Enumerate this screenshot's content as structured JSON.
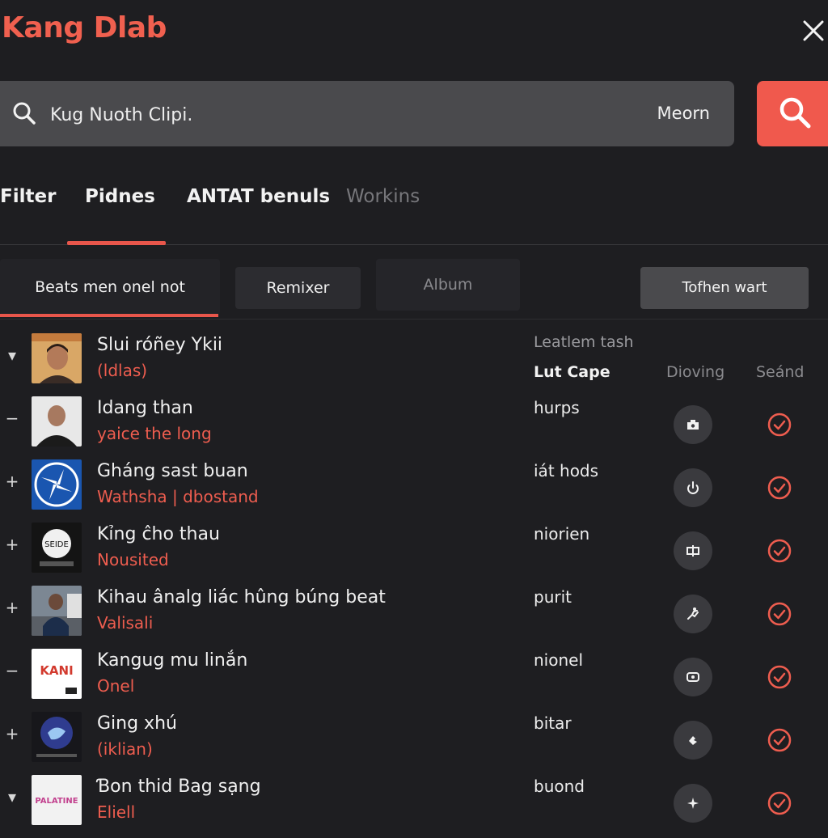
{
  "app": {
    "logo": "Kang Dlab"
  },
  "search": {
    "value": "Kug Nuoth Clipi.",
    "aux_label": "Meorn"
  },
  "tabs": [
    {
      "label": "Filter"
    },
    {
      "label": "Pidnes"
    },
    {
      "label": "ANTAT benuls"
    },
    {
      "label": "Workins"
    }
  ],
  "chips": {
    "active": "Beats men onel not",
    "remixer": "Remixer",
    "album": "Album",
    "right": "Tofhen wart"
  },
  "columns": {
    "group": "Leatlem tash",
    "lut": "Lut Cape",
    "diov": "Dioving",
    "seand": "Seánd"
  },
  "rows": [
    {
      "toggle": "▾",
      "title": "Slui róñey Ykii",
      "subtitle": "(ldlas)",
      "meta": ""
    },
    {
      "toggle": "−",
      "title": "Idang than",
      "subtitle": "yaice the long",
      "meta": "hurps"
    },
    {
      "toggle": "+",
      "title": "Gháng sast buan",
      "subtitle": "Wathsha | dbostand",
      "meta": "iát hods"
    },
    {
      "toggle": "+",
      "title": "Kỉng ĉho thau",
      "subtitle": "Nousited",
      "meta": "niorien"
    },
    {
      "toggle": "+",
      "title": "Kihau ânalg liác hûng búng beat",
      "subtitle": "Valisali",
      "meta": "purit"
    },
    {
      "toggle": "−",
      "title": "Kangug mu linắn",
      "subtitle": "Onel",
      "meta": "nionel"
    },
    {
      "toggle": "+",
      "title": "Ging xhú",
      "subtitle": "(iklian)",
      "meta": "bitar"
    },
    {
      "toggle": "▾",
      "title": "Ɓon thid Bag sạng",
      "subtitle": "Eliell",
      "meta": "buond"
    }
  ],
  "thumb_labels": {
    "t4": "SEIDE",
    "t6": "KANI",
    "t8": "PALATINE"
  },
  "colors": {
    "accent": "#f0594d",
    "bg": "#1e1e21",
    "surface": "#4a4a4d"
  }
}
